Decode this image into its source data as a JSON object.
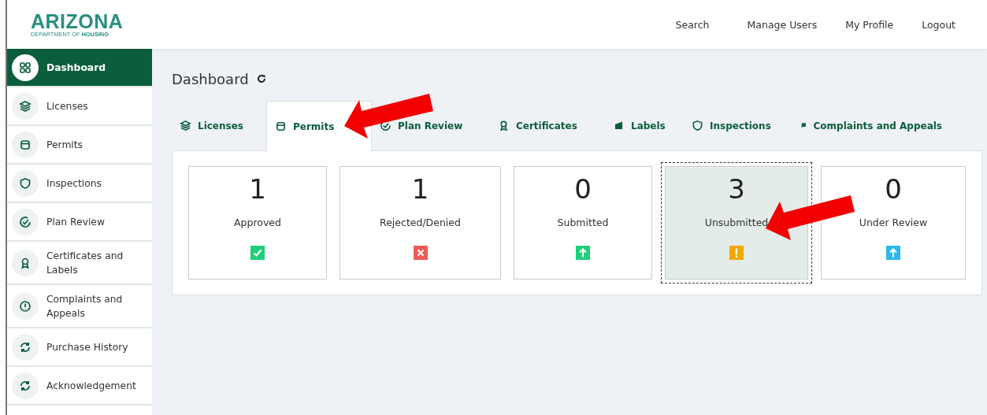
{
  "logo": {
    "name": "ARIZONA",
    "subtitle_plain": "DEPARTMENT OF ",
    "subtitle_bold": "HOUSING"
  },
  "top_nav": [
    "Search",
    "Manage Users",
    "My Profile",
    "Logout"
  ],
  "sidebar": {
    "items": [
      {
        "label": "Dashboard",
        "selected": true
      },
      {
        "label": "Licenses",
        "selected": false
      },
      {
        "label": "Permits",
        "selected": false
      },
      {
        "label": "Inspections",
        "selected": false
      },
      {
        "label": "Plan Review",
        "selected": false
      },
      {
        "label": "Certificates and Labels",
        "selected": false
      },
      {
        "label": "Complaints and Appeals",
        "selected": false
      },
      {
        "label": "Purchase History",
        "selected": false
      },
      {
        "label": "Acknowledgement",
        "selected": false
      }
    ]
  },
  "page_title": "Dashboard",
  "tabs": [
    {
      "label": "Licenses",
      "selected": false
    },
    {
      "label": "Permits",
      "selected": true
    },
    {
      "label": "Plan Review",
      "selected": false
    },
    {
      "label": "Certificates",
      "selected": false
    },
    {
      "label": "Labels",
      "selected": false
    },
    {
      "label": "Inspections",
      "selected": false
    },
    {
      "label": "Complaints and Appeals",
      "selected": false
    }
  ],
  "cards": [
    {
      "count": "1",
      "label": "Approved",
      "kind": "approved",
      "selected": false
    },
    {
      "count": "1",
      "label": "Rejected/Denied",
      "kind": "rejected",
      "selected": false
    },
    {
      "count": "0",
      "label": "Submitted",
      "kind": "submitted",
      "selected": false
    },
    {
      "count": "3",
      "label": "Unsubmitted",
      "kind": "unsubmitted",
      "selected": true
    },
    {
      "count": "0",
      "label": "Under Review",
      "kind": "under_review",
      "selected": false
    }
  ]
}
